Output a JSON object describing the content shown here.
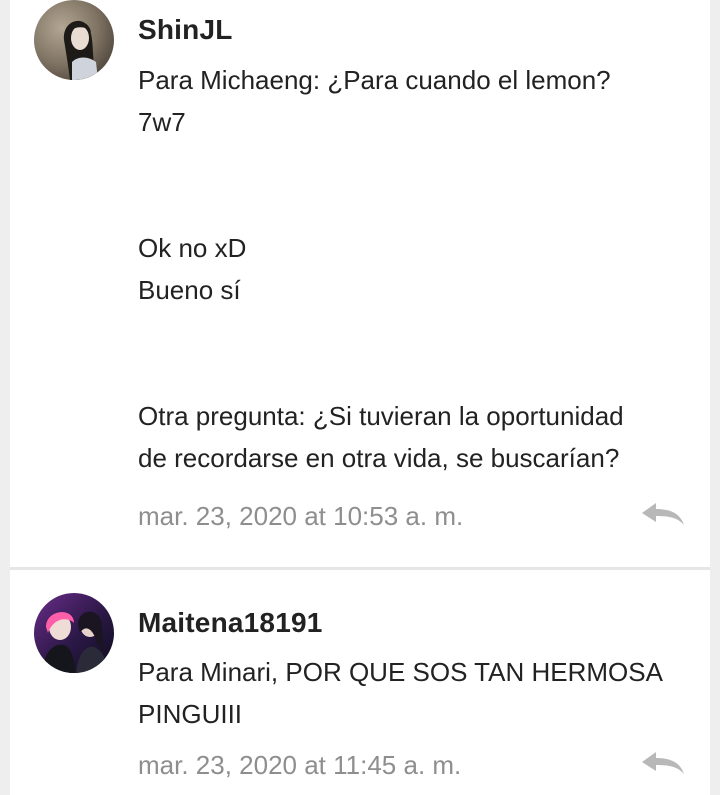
{
  "comments": [
    {
      "username": "ShinJL",
      "lines": [
        "Para Michaeng: ¿Para cuando el lemon?",
        "7w7",
        "",
        "",
        "Ok no xD",
        "Bueno sí",
        "",
        "",
        "Otra pregunta: ¿Si tuvieran la oportunidad",
        "de recordarse en otra vida, se buscarían?"
      ],
      "timestamp": "mar. 23, 2020 at 10:53 a. m.",
      "reply_icon": "reply-arrow-icon"
    },
    {
      "username": "Maitena18191",
      "lines": [
        "Para Minari, POR QUE SOS TAN HERMOSA",
        "PINGUIII"
      ],
      "timestamp": "mar. 23, 2020 at 11:45 a. m.",
      "reply_icon": "reply-arrow-icon"
    }
  ],
  "colors": {
    "background": "#eeeeee",
    "card": "#ffffff",
    "text": "#222222",
    "timestamp": "#8e8e8e",
    "reply_icon": "#b8b8b8"
  }
}
